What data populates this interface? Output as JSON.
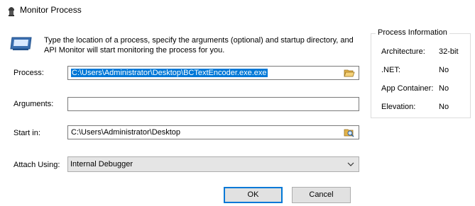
{
  "window": {
    "title": "Monitor Process"
  },
  "banner": {
    "text": "Type the location of a process, specify the arguments (optional) and startup directory, and API Monitor will start monitoring the process for you."
  },
  "form": {
    "process": {
      "label": "Process:",
      "value": "C:\\Users\\Administrator\\Desktop\\BCTextEncoder.exe.exe"
    },
    "arguments": {
      "label": "Arguments:",
      "value": ""
    },
    "start_in": {
      "label": "Start in:",
      "value": "C:\\Users\\Administrator\\Desktop"
    },
    "attach_using": {
      "label": "Attach Using:",
      "value": "Internal Debugger"
    }
  },
  "process_info": {
    "title": "Process Information",
    "items": [
      {
        "key": "Architecture:",
        "value": "32-bit"
      },
      {
        "key": ".NET:",
        "value": "No"
      },
      {
        "key": "App Container:",
        "value": "No"
      },
      {
        "key": "Elevation:",
        "value": "No"
      }
    ]
  },
  "buttons": {
    "ok": "OK",
    "cancel": "Cancel"
  },
  "colors": {
    "selection": "#0078d7",
    "default_button_border": "#0078d7"
  },
  "icons": [
    "app-icon",
    "monitor-icon",
    "folder-open-icon",
    "folder-search-icon",
    "chevron-down-icon"
  ]
}
